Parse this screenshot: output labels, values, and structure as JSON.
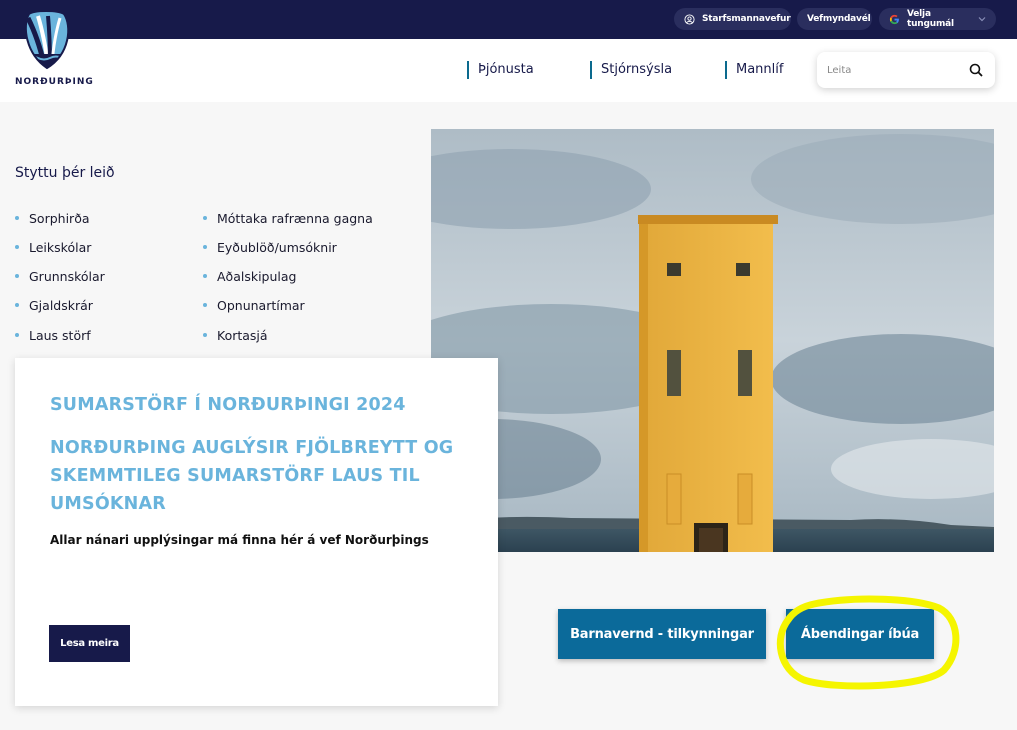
{
  "topbar": {
    "staff_label": "Starfsmannavefur",
    "sitemap_label": "Vefmyndavél",
    "language_label": "Velja tungumál"
  },
  "header": {
    "logo_text": "NORÐURÞING",
    "nav": [
      {
        "label": "Þjónusta"
      },
      {
        "label": "Stjórnsýsla"
      },
      {
        "label": "Mannlíf"
      }
    ],
    "search_placeholder": "Leita"
  },
  "shortcuts": {
    "title": "Styttu þér leið",
    "col1": [
      "Sorphirða",
      "Leikskólar",
      "Grunnskólar",
      "Gjaldskrár",
      "Laus störf"
    ],
    "col2": [
      "Móttaka rafrænna gagna",
      "Eyðublöð/umsóknir",
      "Aðalskipulag",
      "Opnunartímar",
      "Kortasjá"
    ]
  },
  "card": {
    "title": "SUMARSTÖRF Í NORÐURÞINGI 2024",
    "subtitle": "NORÐURÞING AUGLÝSIR FJÖLBREYTT OG SKEMMTILEG SUMARSTÖRF LAUS TIL UMSÓKNAR",
    "body": "Allar nánari upplýsingar má finna hér á vef Norðurþings",
    "button": "Lesa meira"
  },
  "actions": {
    "child_protection": "Barnavernd - tilkynningar",
    "resident_feedback": "Ábendingar íbúa"
  },
  "colors": {
    "navy": "#171a4a",
    "accent_blue": "#0b6a9a",
    "light_blue": "#6ab4dc",
    "highlight": "#f5f500"
  }
}
